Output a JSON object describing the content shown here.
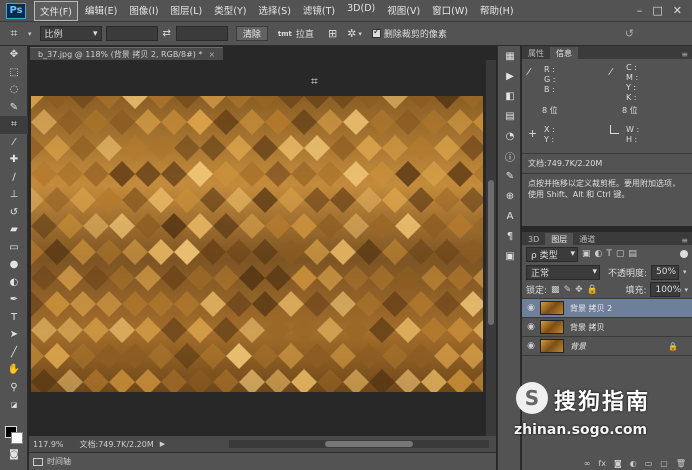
{
  "app": {
    "logo": "Ps"
  },
  "menu": [
    "文件(F)",
    "编辑(E)",
    "图像(I)",
    "图层(L)",
    "类型(Y)",
    "选择(S)",
    "滤镜(T)",
    "3D(D)",
    "视图(V)",
    "窗口(W)",
    "帮助(H)"
  ],
  "window_controls": [
    "–",
    "□",
    "✕"
  ],
  "options": {
    "ratio_label": "比例",
    "clear_label": "清除",
    "straighten_label": "拉直",
    "delete_cropped_label": "删除裁剪的像素",
    "straighten_icon_text": "tmt",
    "swap_icon": "swap-icon",
    "reset_icon": "↺"
  },
  "document": {
    "tab_title": "b_37.jpg @ 118% (背景 拷贝 2, RGB/8#) *",
    "zoom": "117.9%",
    "doc_info": "文档:749.7K/2.20M"
  },
  "timeline_label": "时间轴",
  "info_panel": {
    "tabs": [
      "属性",
      "信息"
    ],
    "rgb_labels": [
      "R :",
      "G :",
      "B :"
    ],
    "cmyk_labels": [
      "C :",
      "M :",
      "Y :",
      "K :"
    ],
    "bit_left": "8 位",
    "bit_right": "8 位",
    "xy_labels": [
      "X :",
      "Y :"
    ],
    "wh_labels": [
      "W :",
      "H :"
    ],
    "doc_info": "文档:749.7K/2.20M",
    "hint": "点按并拖移以定义裁剪框。要用附加选项，使用 Shift、Alt 和 Ctrl 键。"
  },
  "layers_panel": {
    "tabs": [
      "3D",
      "图层",
      "通道"
    ],
    "filter_label": "ρ 类型",
    "blend_mode": "正常",
    "opacity_label": "不透明度:",
    "opacity_value": "50%",
    "lock_label": "锁定:",
    "fill_label": "填充:",
    "fill_value": "100%",
    "layers": [
      {
        "name": "背景 拷贝 2",
        "selected": true,
        "locked": false
      },
      {
        "name": "背景 拷贝",
        "selected": false,
        "locked": false
      },
      {
        "name": "背景",
        "selected": false,
        "locked": true
      }
    ]
  },
  "watermark": {
    "logo": "S",
    "title": "搜狗指南",
    "url": "zhinan.sogo.com"
  }
}
